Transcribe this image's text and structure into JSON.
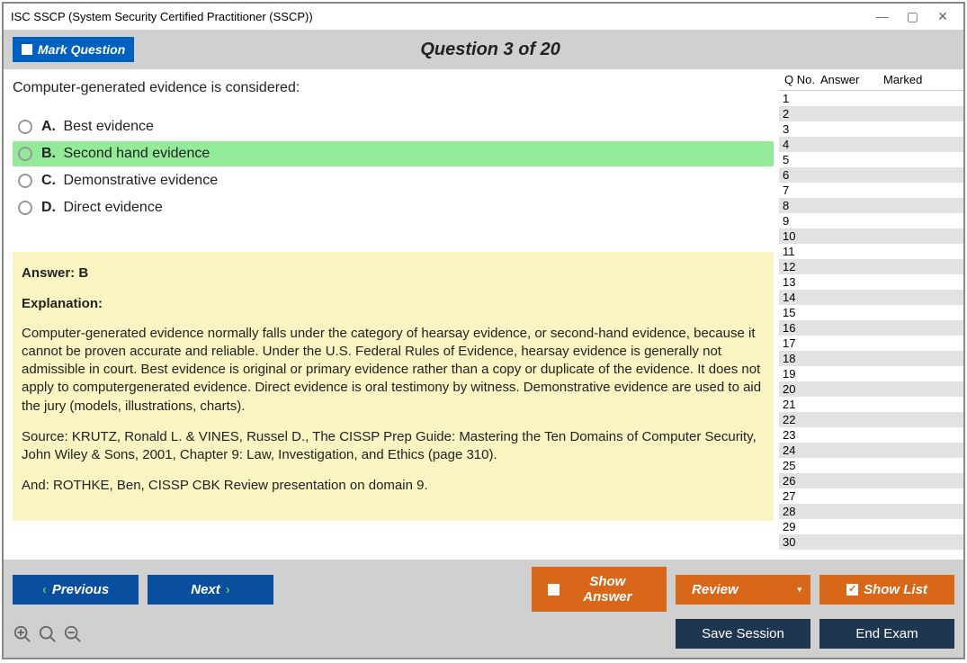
{
  "window": {
    "title": "ISC SSCP (System Security Certified Practitioner (SSCP))"
  },
  "header": {
    "mark_label": "Mark Question",
    "counter": "Question 3 of 20"
  },
  "question": {
    "prompt": "Computer-generated evidence is considered:",
    "options": [
      {
        "letter": "A.",
        "text": "Best evidence",
        "correct": false
      },
      {
        "letter": "B.",
        "text": "Second hand evidence",
        "correct": true
      },
      {
        "letter": "C.",
        "text": "Demonstrative evidence",
        "correct": false
      },
      {
        "letter": "D.",
        "text": "Direct evidence",
        "correct": false
      }
    ]
  },
  "explanation": {
    "answer_label": "Answer: B",
    "heading": "Explanation:",
    "para1": "Computer-generated evidence normally falls under the category of hearsay evidence, or second-hand evidence, because it cannot be proven accurate and reliable. Under the U.S. Federal Rules of Evidence, hearsay evidence is generally not admissible in court. Best evidence is original or primary evidence rather than a copy or duplicate of the evidence. It does not apply to computergenerated evidence. Direct evidence is oral testimony by witness. Demonstrative evidence are used to aid the jury (models, illustrations, charts).",
    "para2": "Source: KRUTZ, Ronald L. & VINES, Russel D., The CISSP Prep Guide: Mastering the Ten Domains of Computer Security, John Wiley & Sons, 2001, Chapter 9: Law, Investigation, and Ethics (page 310).",
    "para3": "And: ROTHKE, Ben, CISSP CBK Review presentation on domain 9."
  },
  "sidebar": {
    "col_qno": "Q No.",
    "col_answer": "Answer",
    "col_marked": "Marked",
    "total_rows": 30
  },
  "footer": {
    "previous": "Previous",
    "next": "Next",
    "show_answer": "Show Answer",
    "review": "Review",
    "show_list": "Show List",
    "save_session": "Save Session",
    "end_exam": "End Exam"
  }
}
